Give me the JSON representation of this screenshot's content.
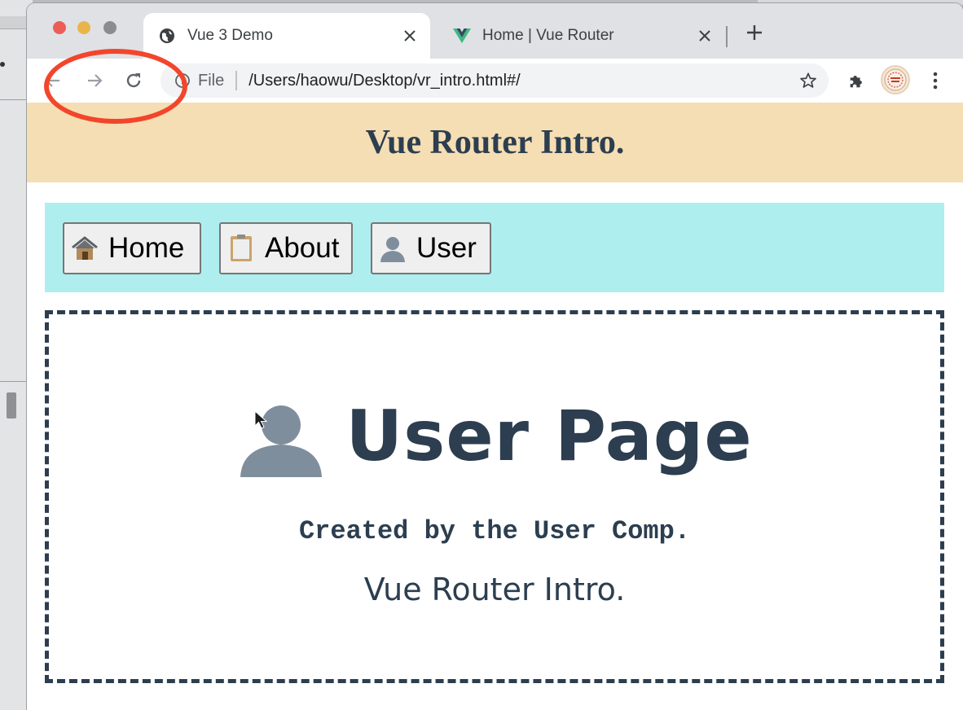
{
  "browser": {
    "tabs": [
      {
        "title": "Vue 3 Demo",
        "icon": "globe-icon",
        "active": true
      },
      {
        "title": "Home | Vue Router",
        "icon": "vue-logo-icon",
        "active": false
      }
    ],
    "new_tab_icon": "plus-icon",
    "toolbar": {
      "back_icon": "arrow-left-icon",
      "forward_icon": "arrow-right-icon",
      "reload_icon": "reload-icon",
      "scheme_label": "File",
      "url": "/Users/haowu/Desktop/vr_intro.html#/",
      "bookmark_icon": "star-icon",
      "extensions_icon": "puzzle-icon",
      "menu_icon": "kebab-menu-icon"
    }
  },
  "annotation": {
    "color": "#f3452b",
    "shape": "ellipse around back/forward/reload buttons"
  },
  "app": {
    "header_title": "Vue Router Intro.",
    "header_bg": "#f5deb3",
    "nav_bg": "#afeeee",
    "text_color": "#2c3e50",
    "nav_buttons": [
      {
        "emoji": "🏚",
        "label": "Home"
      },
      {
        "emoji": "📋",
        "label": "About"
      },
      {
        "emoji": "👤",
        "label": "User"
      }
    ],
    "view": {
      "title_emoji": "👤",
      "title": "User Page",
      "subtitle": "Created by the User Comp.",
      "footer": "Vue Router Intro."
    }
  }
}
